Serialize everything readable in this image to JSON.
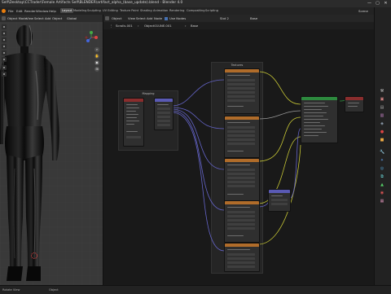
{
  "window": {
    "title": "Self\\Desktop\\CCTrader\\Female Artifacts Self\\BLENDER\\artifact_alpha_(base_update).blend - Blender 4.0",
    "minimize": "—",
    "maximize": "▢",
    "close": "✕"
  },
  "menu": {
    "items": [
      "File",
      "Edit",
      "Render",
      "Window",
      "Help"
    ],
    "workspaces": [
      "Layout",
      "Modeling",
      "Sculpting",
      "UV Editing",
      "Texture Paint",
      "Shading",
      "Animation",
      "Rendering",
      "Compositing",
      "Scripting"
    ],
    "active_workspace": "Layout",
    "scene_label": "Scene"
  },
  "viewport": {
    "mode": "Object Mode",
    "menu": [
      "View",
      "Select",
      "Add",
      "Object"
    ],
    "transform": "Global"
  },
  "node_editor": {
    "editor_type": "Object",
    "menu": [
      "View",
      "Select",
      "Add",
      "Node"
    ],
    "use_nodes_label": "Use Nodes",
    "slot": "Slot 2",
    "material": "Base",
    "breadcrumbs": [
      "Scrolls.001",
      "Object01UNE.001",
      "Base"
    ]
  },
  "frames": {
    "mapping": "Mapping",
    "textures": "Textures"
  },
  "statusbar": {
    "left": "Rotate View",
    "center": "Object"
  },
  "colors": {
    "accent": "#4772b3",
    "node_texture_header": "#b06c2a",
    "node_vector_header": "#5a5ab4",
    "node_shader_header": "#2d8a3e",
    "node_output_header": "#8a2d2d",
    "wire_yellow": "#c7c735",
    "wire_purple": "#6464c8",
    "wire_gray": "#9a9a9a"
  }
}
